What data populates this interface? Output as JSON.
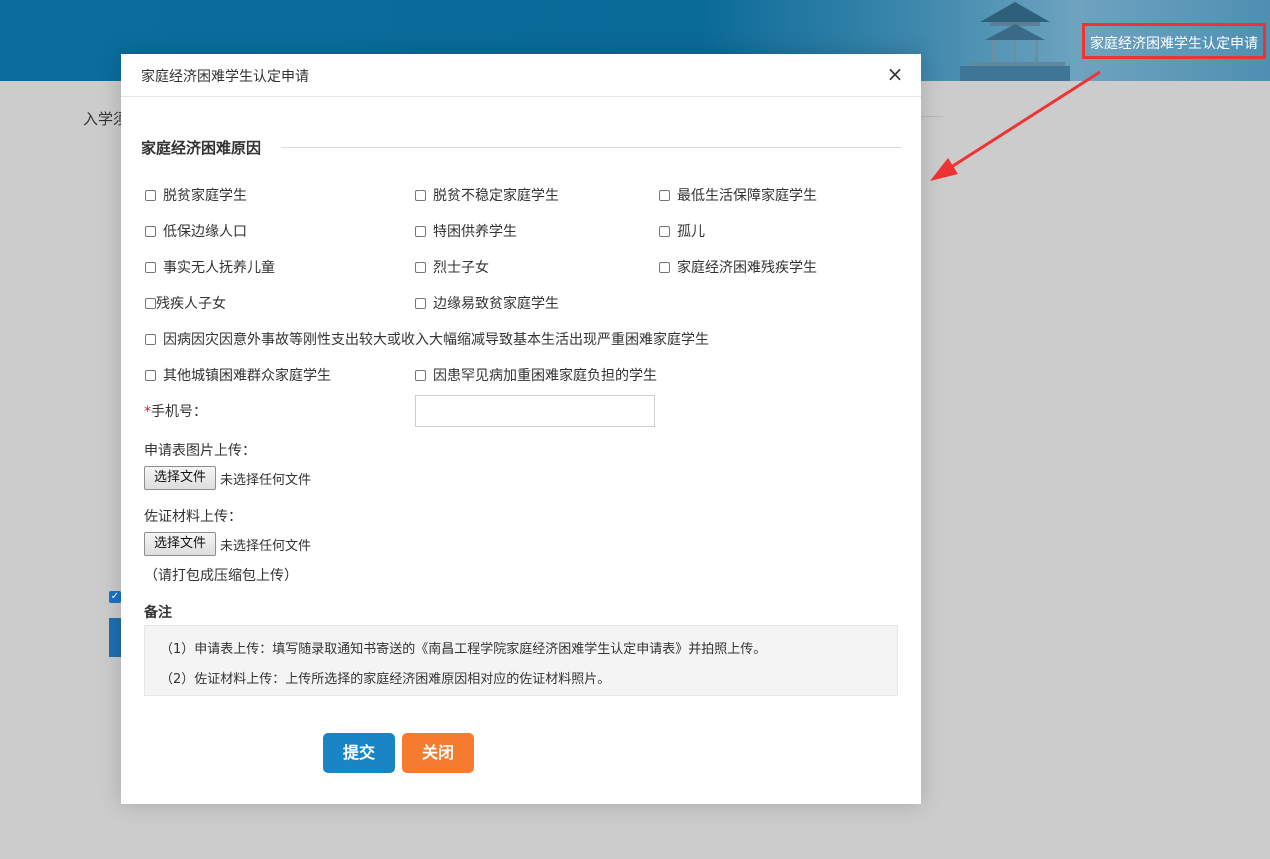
{
  "banner": {
    "link_label": "家庭经济困难学生认定申请",
    "highlight_color": "#ee3333"
  },
  "background": {
    "page_text": "入学须"
  },
  "modal": {
    "title": "家庭经济困难学生认定申请",
    "close_icon": "close-icon",
    "section_title": "家庭经济困难原因",
    "reasons": [
      "脱贫家庭学生",
      "脱贫不稳定家庭学生",
      "最低生活保障家庭学生",
      "低保边缘人口",
      "特困供养学生",
      "孤儿",
      "事实无人抚养儿童",
      "烈士子女",
      "家庭经济困难残疾学生",
      "残疾人子女",
      "边缘易致贫家庭学生",
      "因病因灾因意外事故等刚性支出较大或收入大幅缩减导致基本生活出现严重困难家庭学生",
      "其他城镇困难群众家庭学生",
      "因患罕见病加重困难家庭负担的学生"
    ],
    "phone": {
      "required_mark": "*",
      "label": "手机号：",
      "value": ""
    },
    "application_upload": {
      "label": "申请表图片上传：",
      "button": "选择文件",
      "status": "未选择任何文件"
    },
    "evidence_upload": {
      "label": "佐证材料上传：",
      "button": "选择文件",
      "status": "未选择任何文件",
      "hint": "（请打包成压缩包上传）"
    },
    "notes": {
      "title": "备注",
      "lines": [
        "（1）申请表上传：填写随录取通知书寄送的《南昌工程学院家庭经济困难学生认定申请表》并拍照上传。",
        "（2）佐证材料上传：上传所选择的家庭经济困难原因相对应的佐证材料照片。"
      ]
    },
    "buttons": {
      "submit": "提交",
      "close": "关闭"
    }
  },
  "colors": {
    "banner": "#0b6d9e",
    "submit": "#1a85c4",
    "close": "#f47b30",
    "required": "#e02020"
  }
}
